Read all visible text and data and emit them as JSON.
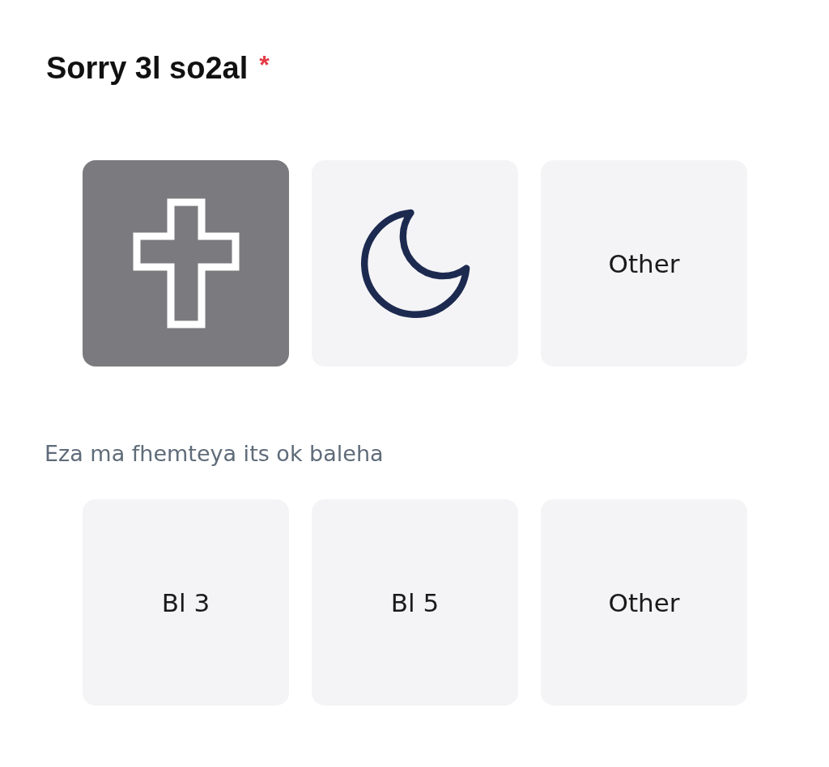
{
  "question": {
    "title": "Sorry 3l so2al",
    "required_mark": "*"
  },
  "options": [
    {
      "kind": "cross",
      "selected": true
    },
    {
      "kind": "crescent",
      "selected": false
    },
    {
      "kind": "text",
      "label": "Other",
      "selected": false
    }
  ],
  "hint": "Eza ma fhemteya its ok baleha",
  "options_2": [
    {
      "kind": "text",
      "label": "Bl 3",
      "selected": false
    },
    {
      "kind": "text",
      "label": "Bl 5",
      "selected": false
    },
    {
      "kind": "text",
      "label": "Other",
      "selected": false
    }
  ]
}
